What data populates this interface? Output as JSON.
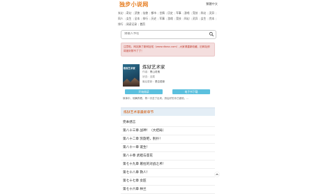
{
  "header": {
    "logo": "独步小说网",
    "traditional": "繁體中文"
  },
  "nav": {
    "items": [
      "玄幻",
      "奇幻",
      "武侠",
      "仙侠",
      "都市",
      "言情",
      "历史",
      "军事",
      "游戏",
      "竞技",
      "科幻",
      "灵异",
      "同人",
      "女生",
      "全本",
      "排行",
      "历史",
      "军事",
      "游戏",
      "竞技",
      "科幻",
      "灵异",
      "女生",
      "完本",
      "排行",
      "阅读记录"
    ],
    "home": "首页"
  },
  "search": {
    "placeholder": "请输入书名"
  },
  "notice": "注意啦，网站换了新网址啦（www.dbxsc.com）,大家请重新收藏，旧网址即将被封禁不了了！",
  "book": {
    "title": "炼狱艺术家",
    "cover_text": "炼狱艺术家",
    "author_label": "作者：",
    "author": "黑山老鬼",
    "status_label": "状态：",
    "status": "连载",
    "update_label": "最后更新：",
    "update": "是否更新",
    "read_button": "开始阅读",
    "download_button": "电子书下载",
    "intro": "故事中，他舞弄着，再一次念了出来。然后好的手已被他，…"
  },
  "chapters": {
    "heading": "炼狱艺术家最新章节",
    "list": [
      "完本感言",
      "第八十三章 战神！（大结局）",
      "第八十二章 凯旋吧，别扑！",
      "第八十一章 诞生！",
      "第八十章 武祖与莲花",
      "第七十九章 葛拉的对战之术！",
      "第七十八章 救人！",
      "第七十七章 女匠",
      "第七十六章 林兰"
    ]
  },
  "colors": {
    "accent": "#e67e22",
    "button": "#5bc0de",
    "notice_bg": "#f4dede"
  }
}
